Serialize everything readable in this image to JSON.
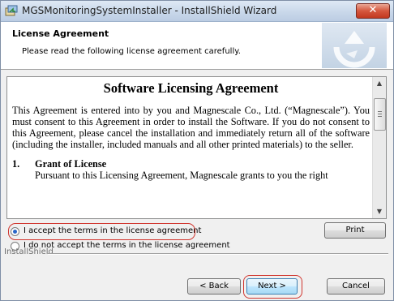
{
  "window": {
    "title": "MGSMonitoringSystemInstaller - InstallShield Wizard",
    "close_glyph": "✕"
  },
  "header": {
    "title": "License Agreement",
    "subtitle": "Please read the following license agreement carefully."
  },
  "license": {
    "title": "Software Licensing Agreement",
    "intro": "This Agreement is entered into by you and Magnescale Co., Ltd. (“Magnescale”). You must consent to this Agreement in order to install the Software. If you do not consent to this Agreement, please cancel the installation and immediately return all of the software (including the installer, included manuals and all other printed materials) to the seller.",
    "section1_number": "1.",
    "section1_heading": "Grant of License",
    "section1_text": "Pursuant to this Licensing Agreement, Magnescale grants to you the right"
  },
  "options": {
    "accept_label": "I accept the terms in the license agreement",
    "decline_label": "I do not accept the terms in the license agreement",
    "selected": "accept"
  },
  "buttons": {
    "print": "Print",
    "back": "< Back",
    "next": "Next >",
    "cancel": "Cancel"
  },
  "footer": {
    "brand": "InstallShield"
  },
  "icons": {
    "app": "installer-icon",
    "logo": "installshield-logo-icon",
    "scroll_up": "scroll-up-arrow-icon",
    "scroll_down": "scroll-down-arrow-icon"
  },
  "colors": {
    "highlight": "#d0362f",
    "close_button": "#d5573e"
  }
}
